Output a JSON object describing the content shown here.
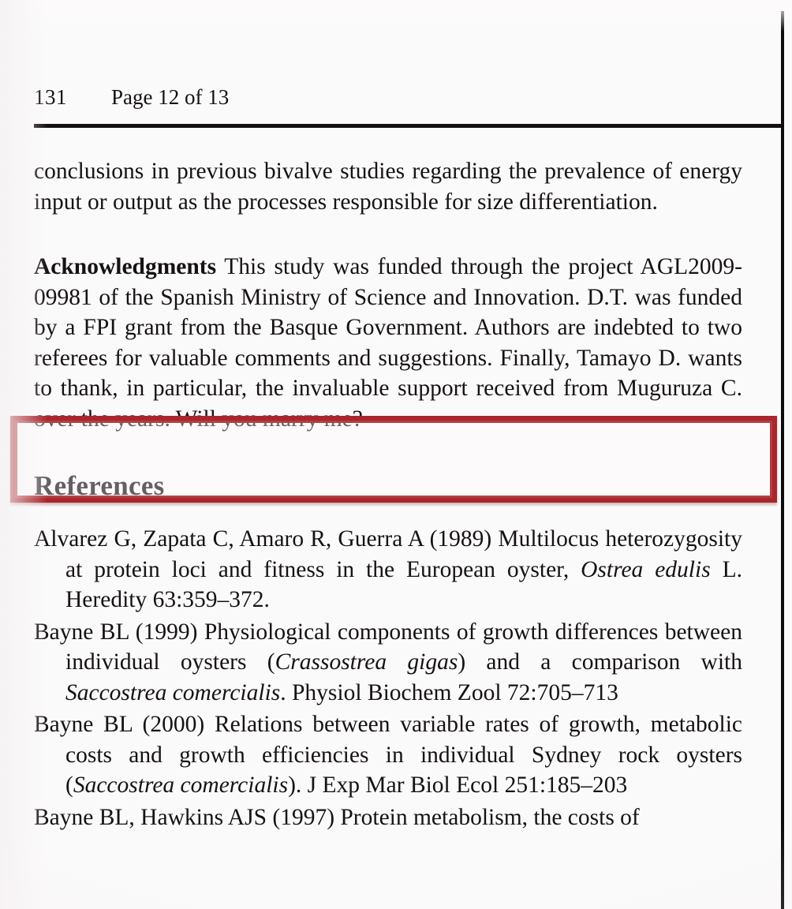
{
  "page": {
    "running_head": {
      "folio": "131",
      "page_of": "Page 12 of 13"
    }
  },
  "body": {
    "continued_paragraph": "conclusions in previous bivalve studies regarding the prevalence of energy input or output as the processes responsible for size differentiation.",
    "acknowledgments": {
      "lead_label": "Acknowledgments",
      "text": " This study was funded through the project AGL2009-09981 of the Spanish Ministry of Science and Innovation. D.T. was funded by a FPI grant from the Basque Government. Authors are indebted to two referees for valuable comments and suggestions. Finally, Tamayo D. wants to thank, in particular, the invaluable support received from Muguruza C. over the years. Will you marry me?"
    }
  },
  "highlight": {
    "color": "#a8262c",
    "highlighted_text": "tions. Finally, Tamayo D. wants to thank, in particular, the invaluable support received from Muguruza C. over the years. Will you marry me?"
  },
  "references": {
    "heading": "References",
    "items": [
      {
        "parts": [
          {
            "text": "Alvarez G, Zapata C, Amaro R, Guerra A (1989) Multilocus heterozygosity at protein loci and fitness in the European oyster, ",
            "italic": false
          },
          {
            "text": "Ostrea edulis",
            "italic": true
          },
          {
            "text": " L. Heredity 63:359–372.",
            "italic": false
          }
        ]
      },
      {
        "parts": [
          {
            "text": "Bayne BL (1999) Physiological components of growth differences between individual oysters (",
            "italic": false
          },
          {
            "text": "Crassostrea gigas",
            "italic": true
          },
          {
            "text": ") and a comparison with ",
            "italic": false
          },
          {
            "text": "Saccostrea comercialis",
            "italic": true
          },
          {
            "text": ". Physiol Biochem Zool 72:705–713",
            "italic": false
          }
        ]
      },
      {
        "parts": [
          {
            "text": "Bayne BL (2000) Relations between variable rates of growth, metabolic costs and growth efficiencies in individual Sydney rock oysters (",
            "italic": false
          },
          {
            "text": "Saccostrea comercialis",
            "italic": true
          },
          {
            "text": "). J Exp Mar Biol Ecol 251:185–203",
            "italic": false
          }
        ]
      },
      {
        "parts": [
          {
            "text": "Bayne BL, Hawkins AJS (1997) Protein metabolism, the costs of",
            "italic": false
          }
        ]
      }
    ]
  }
}
